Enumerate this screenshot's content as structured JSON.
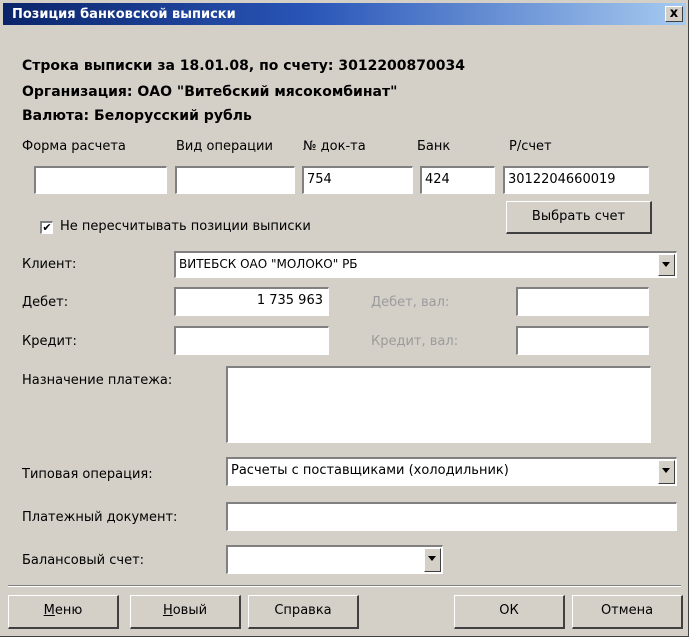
{
  "window": {
    "title": "Позиция банковской выписки",
    "close_label": "x"
  },
  "header": {
    "line1": "Строка выписки за 18.01.08, по счету: 3012200870034",
    "line2": "Организация: ОАО \"Витебский мясокомбинат\"",
    "line3": "Валюта: Белорусский рубль"
  },
  "columns": {
    "forma_label": "Форма расчета",
    "vid_label": "Вид операции",
    "doc_label": "№ док-та",
    "bank_label": "Банк",
    "account_label": "Р/счет",
    "forma_value": "",
    "vid_value": "",
    "doc_value": "754",
    "bank_value": "424",
    "account_value": "3012204660019"
  },
  "checkbox": {
    "checked": true,
    "mark": "✔",
    "label": "Не пересчитывать позиции выписки"
  },
  "buttons": {
    "select_account": "Выбрать счет",
    "menu_prefix": "М",
    "menu_rest": "еню",
    "new_prefix": "Н",
    "new_rest": "овый",
    "help": "Справка",
    "ok": "ОК",
    "cancel": "Отмена"
  },
  "client": {
    "label": "Клиент:",
    "value": "ВИТЕБСК ОАО \"МОЛОКО\" РБ"
  },
  "debit": {
    "label": "Дебет:",
    "value": "1 735 963",
    "cur_label": "Дебет, вал:",
    "cur_value": ""
  },
  "credit": {
    "label": "Кредит:",
    "value": "",
    "cur_label": "Кредит, вал:",
    "cur_value": ""
  },
  "purpose": {
    "label": "Назначение платежа:",
    "value": ""
  },
  "operation": {
    "label": "Типовая операция:",
    "value": "Расчеты с поставщиками (холодильник)"
  },
  "payment_doc": {
    "label": "Платежный документ:",
    "value": ""
  },
  "balance_account": {
    "label": "Балансовый счет:",
    "value": ""
  }
}
